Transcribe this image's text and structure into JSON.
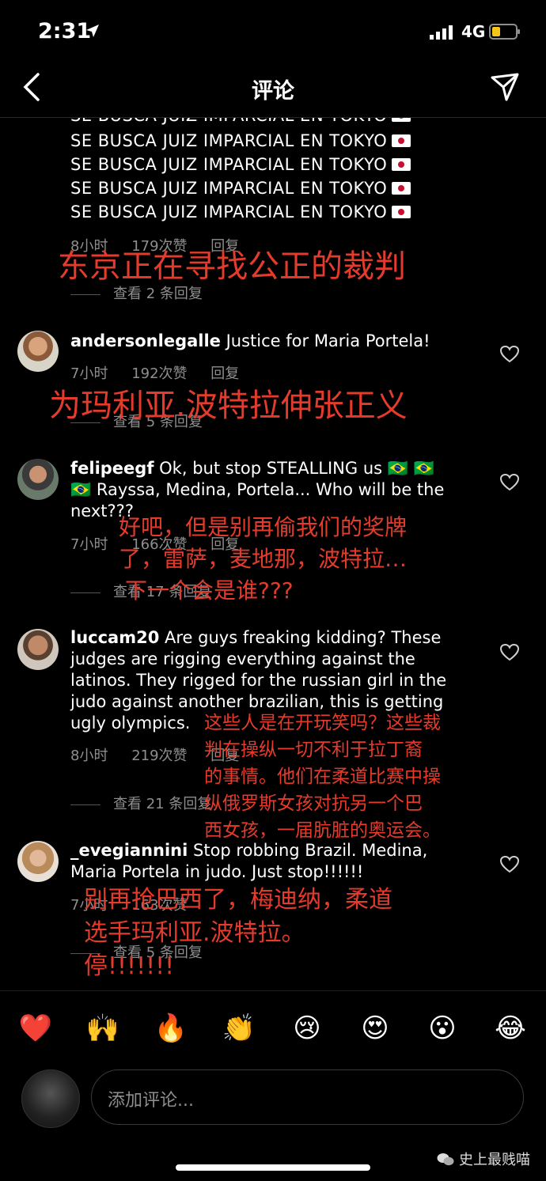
{
  "status_bar": {
    "time": "2:31",
    "network": "4G"
  },
  "header": {
    "title": "评论"
  },
  "comment0": {
    "lines": [
      "SE BUSCA JUIZ IMPARCIAL EN TOKYO",
      "SE BUSCA JUIZ IMPARCIAL EN TOKYO",
      "SE BUSCA JUIZ IMPARCIAL EN TOKYO",
      "SE BUSCA JUIZ IMPARCIAL EN TOKYO",
      "SE BUSCA JUIZ IMPARCIAL EN TOKYO"
    ],
    "time": "8小时",
    "likes": "179次赞",
    "reply": "回复",
    "view_replies": "查看 2 条回复",
    "overlay": "东京正在寻找公正的裁判"
  },
  "comment1": {
    "user": "andersonlegalle",
    "text": "Justice for Maria Portela!",
    "time": "7小时",
    "likes": "192次赞",
    "reply": "回复",
    "view_replies": "查看 5 条回复",
    "overlay": "为玛利亚.波特拉伸张正义"
  },
  "comment2": {
    "user": "felipeegf",
    "text": "Ok, but stop STEALLING us 🇧🇷 🇧🇷 🇧🇷 Rayssa, Medina, Portela... Who will be the next???",
    "time": "7小时",
    "likes": "166次赞",
    "reply": "回复",
    "view_replies": "查看 17 条回复",
    "overlay": [
      "好吧，但是别再偷我们的奖牌",
      "了，雷萨，麦地那，波特拉…",
      "下一个会是谁???"
    ]
  },
  "comment3": {
    "user": "luccam20",
    "text": "Are guys freaking kidding? These judges are rigging everything against the latinos. They rigged for the russian girl in the judo against another brazilian, this is getting ugly olympics.",
    "time": "8小时",
    "likes": "219次赞",
    "reply": "回复",
    "view_replies": "查看 21 条回复",
    "overlay": [
      "这些人是在开玩笑吗？这些裁",
      "判在操纵一切不利于拉丁裔",
      "的事情。他们在柔道比赛中操",
      "纵俄罗斯女孩对抗另一个巴",
      "西女孩，一届肮脏的奥运会。"
    ]
  },
  "comment4": {
    "user": "_evegiannini",
    "text": "Stop robbing Brazil. Medina, Maria Portela in judo. Just stop!!!!!!",
    "time": "7小时",
    "likes": "163次赞",
    "view_replies": "查看 5 条回复",
    "overlay": [
      "别再抢巴西了，梅迪纳，柔道",
      "选手玛利亚.波特拉。",
      "停!!!!!!!"
    ]
  },
  "emoji_bar": [
    "❤️",
    "🙌",
    "🔥",
    "👏",
    "😢",
    "😍",
    "😮",
    "😂"
  ],
  "composer": {
    "placeholder": "添加评论..."
  },
  "watermark": "史上最贱喵"
}
